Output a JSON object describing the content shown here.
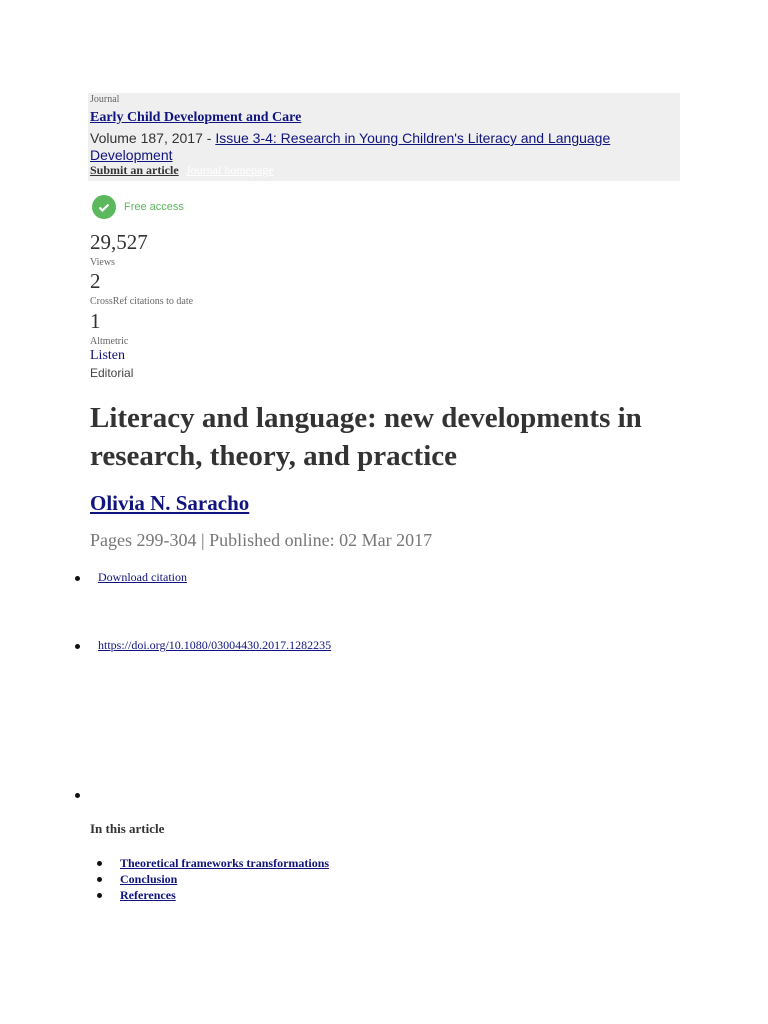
{
  "journal": {
    "label": "Journal",
    "title": "Early Child Development and Care ",
    "volume": "Volume 187, 2017 - ",
    "issue": "Issue 3-4: Research in Young Children's Literacy and Language Development",
    "submit": "Submit an article",
    "homepage": "Journal homepage"
  },
  "access": {
    "label": "Free access",
    "color": "#5cb85c"
  },
  "metrics": [
    {
      "value": "29,527",
      "label": "Views"
    },
    {
      "value": "2",
      "label": "CrossRef citations to date"
    },
    {
      "value": "1",
      "label": "Altmetric"
    }
  ],
  "listen": "Listen",
  "article_type": "Editorial",
  "article": {
    "title": "Literacy and language: new developments in research, theory, and practice",
    "author": "Olivia N. Saracho",
    "meta": "Pages 299-304 | Published online: 02 Mar 2017"
  },
  "links": {
    "download": "Download citation",
    "doi": "https://doi.org/10.1080/03004430.2017.1282235"
  },
  "toc": {
    "heading": "In this article",
    "items": [
      "Theoretical frameworks transformations",
      "Conclusion",
      "References"
    ]
  }
}
